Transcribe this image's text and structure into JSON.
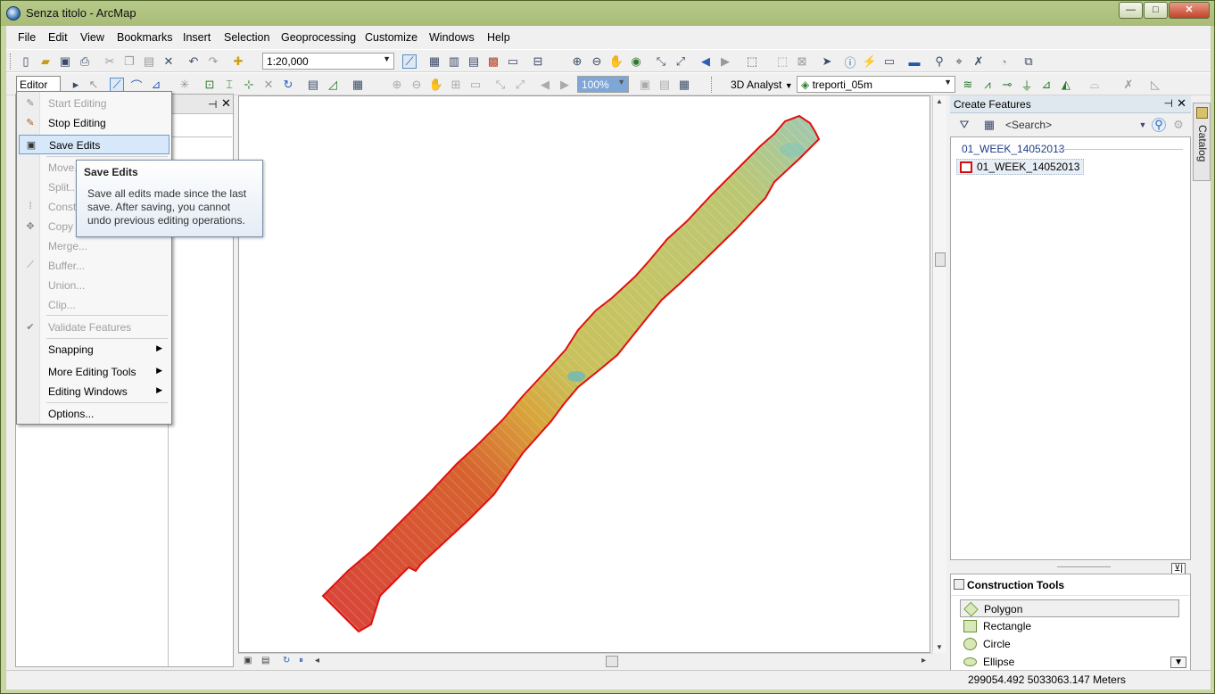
{
  "window": {
    "title": "Senza titolo - ArcMap",
    "min": "—",
    "max": "□",
    "close": "✕"
  },
  "menu": [
    "File",
    "Edit",
    "View",
    "Bookmarks",
    "Insert",
    "Selection",
    "Geoprocessing",
    "Customize",
    "Windows",
    "Help"
  ],
  "toolbar": {
    "scale": "1:20,000",
    "editor_label": "Editor",
    "zoom_value": "100%",
    "analyst_label": "3D Analyst",
    "layer_combo": "treporti_05m"
  },
  "editor_menu": {
    "items": [
      {
        "label": "Start Editing",
        "enabled": false
      },
      {
        "label": "Stop Editing",
        "enabled": true
      },
      {
        "label": "Save Edits",
        "enabled": true,
        "highlighted": true
      },
      {
        "label": "Move...",
        "enabled": false
      },
      {
        "label": "Split...",
        "enabled": false
      },
      {
        "label": "Const",
        "enabled": false
      },
      {
        "label": "Copy",
        "enabled": false
      },
      {
        "label": "Merge...",
        "enabled": false
      },
      {
        "label": "Buffer...",
        "enabled": false
      },
      {
        "label": "Union...",
        "enabled": false
      },
      {
        "label": "Clip...",
        "enabled": false
      },
      {
        "label": "Validate Features",
        "enabled": false
      },
      {
        "label": "Snapping",
        "enabled": true,
        "submenu": true
      },
      {
        "label": "More Editing Tools",
        "enabled": true,
        "submenu": true
      },
      {
        "label": "Editing Windows",
        "enabled": true,
        "submenu": true
      },
      {
        "label": "Options...",
        "enabled": true
      }
    ]
  },
  "tooltip": {
    "title": "Save Edits",
    "line1": "Save all edits made since the last",
    "line2": "save. After saving, you cannot",
    "line3": "undo previous editing operations."
  },
  "create_features": {
    "title": "Create Features",
    "search_placeholder": "<Search>",
    "group": "01_WEEK_14052013",
    "template": "01_WEEK_14052013"
  },
  "construction_tools": {
    "title": "Construction Tools",
    "tools": [
      "Polygon",
      "Rectangle",
      "Circle",
      "Ellipse"
    ]
  },
  "catalog_tab": "Catalog",
  "status": {
    "coordinates": "299054.492  5033063.147 Meters"
  },
  "colors": {
    "feature_outline": "#e01010",
    "highlight": "#d7e8fa",
    "window_frame": "#a9bd78"
  }
}
